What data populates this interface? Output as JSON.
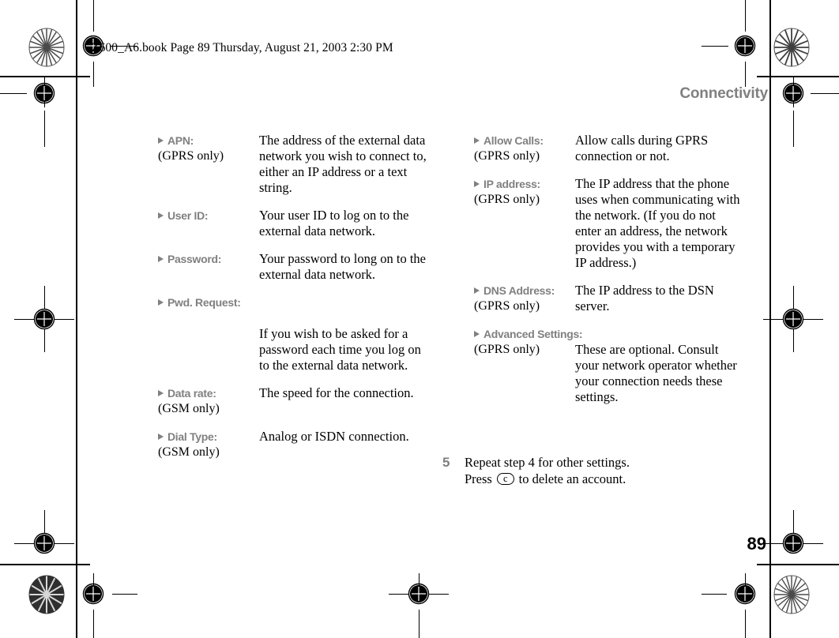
{
  "header": {
    "book_line": "Z600_A6.book  Page 89  Thursday, August 21, 2003  2:30 PM",
    "chapter_title": "Connectivity",
    "page_number": "89"
  },
  "columns": {
    "left": [
      {
        "term": "APN:",
        "qualifier": "(GPRS only)",
        "description": "The address of the external data network you wish to connect to, either an IP address or a text string.",
        "stacked": false
      },
      {
        "term": "User ID:",
        "qualifier": "",
        "description": "Your user ID to log on to the external data network.",
        "stacked": false
      },
      {
        "term": "Password:",
        "qualifier": "",
        "description": "Your password to long on to the external data network.",
        "stacked": false
      },
      {
        "term": "Pwd. Request:",
        "qualifier": "",
        "description": "If you wish to be asked for a password each time you log on to the external data network.",
        "stacked": true
      },
      {
        "term": "Data rate:",
        "qualifier": "(GSM only)",
        "description": "The speed for the connection.",
        "stacked": false
      },
      {
        "term": "Dial Type:",
        "qualifier": "(GSM only)",
        "description": "Analog or ISDN connection.",
        "stacked": false
      }
    ],
    "right": [
      {
        "term": "Allow Calls:",
        "qualifier": "(GPRS only)",
        "description": "Allow calls during GPRS connection or not.",
        "stacked": false
      },
      {
        "term": "IP address:",
        "qualifier": "(GPRS only)",
        "description": "The IP address that the phone uses when communicating with the network. (If you do not enter an address, the network provides you with a temporary IP address.)",
        "stacked": false
      },
      {
        "term": "DNS Address:",
        "qualifier": "(GPRS only)",
        "description": "The IP address to the DSN server.",
        "stacked": false
      },
      {
        "term": "Advanced Settings:",
        "qualifier": "(GPRS only)",
        "description": "These are optional. Consult your network operator whether your connection needs these settings.",
        "stacked": false,
        "term_wraps": true
      }
    ]
  },
  "step": {
    "number": "5",
    "line1": "Repeat step 4 for other settings.",
    "line2_before": "Press",
    "key_label": "c",
    "line2_after": "to delete an account."
  },
  "colors": {
    "label_gray": "#808080",
    "body_black": "#000000",
    "page_background": "#ffffff"
  }
}
